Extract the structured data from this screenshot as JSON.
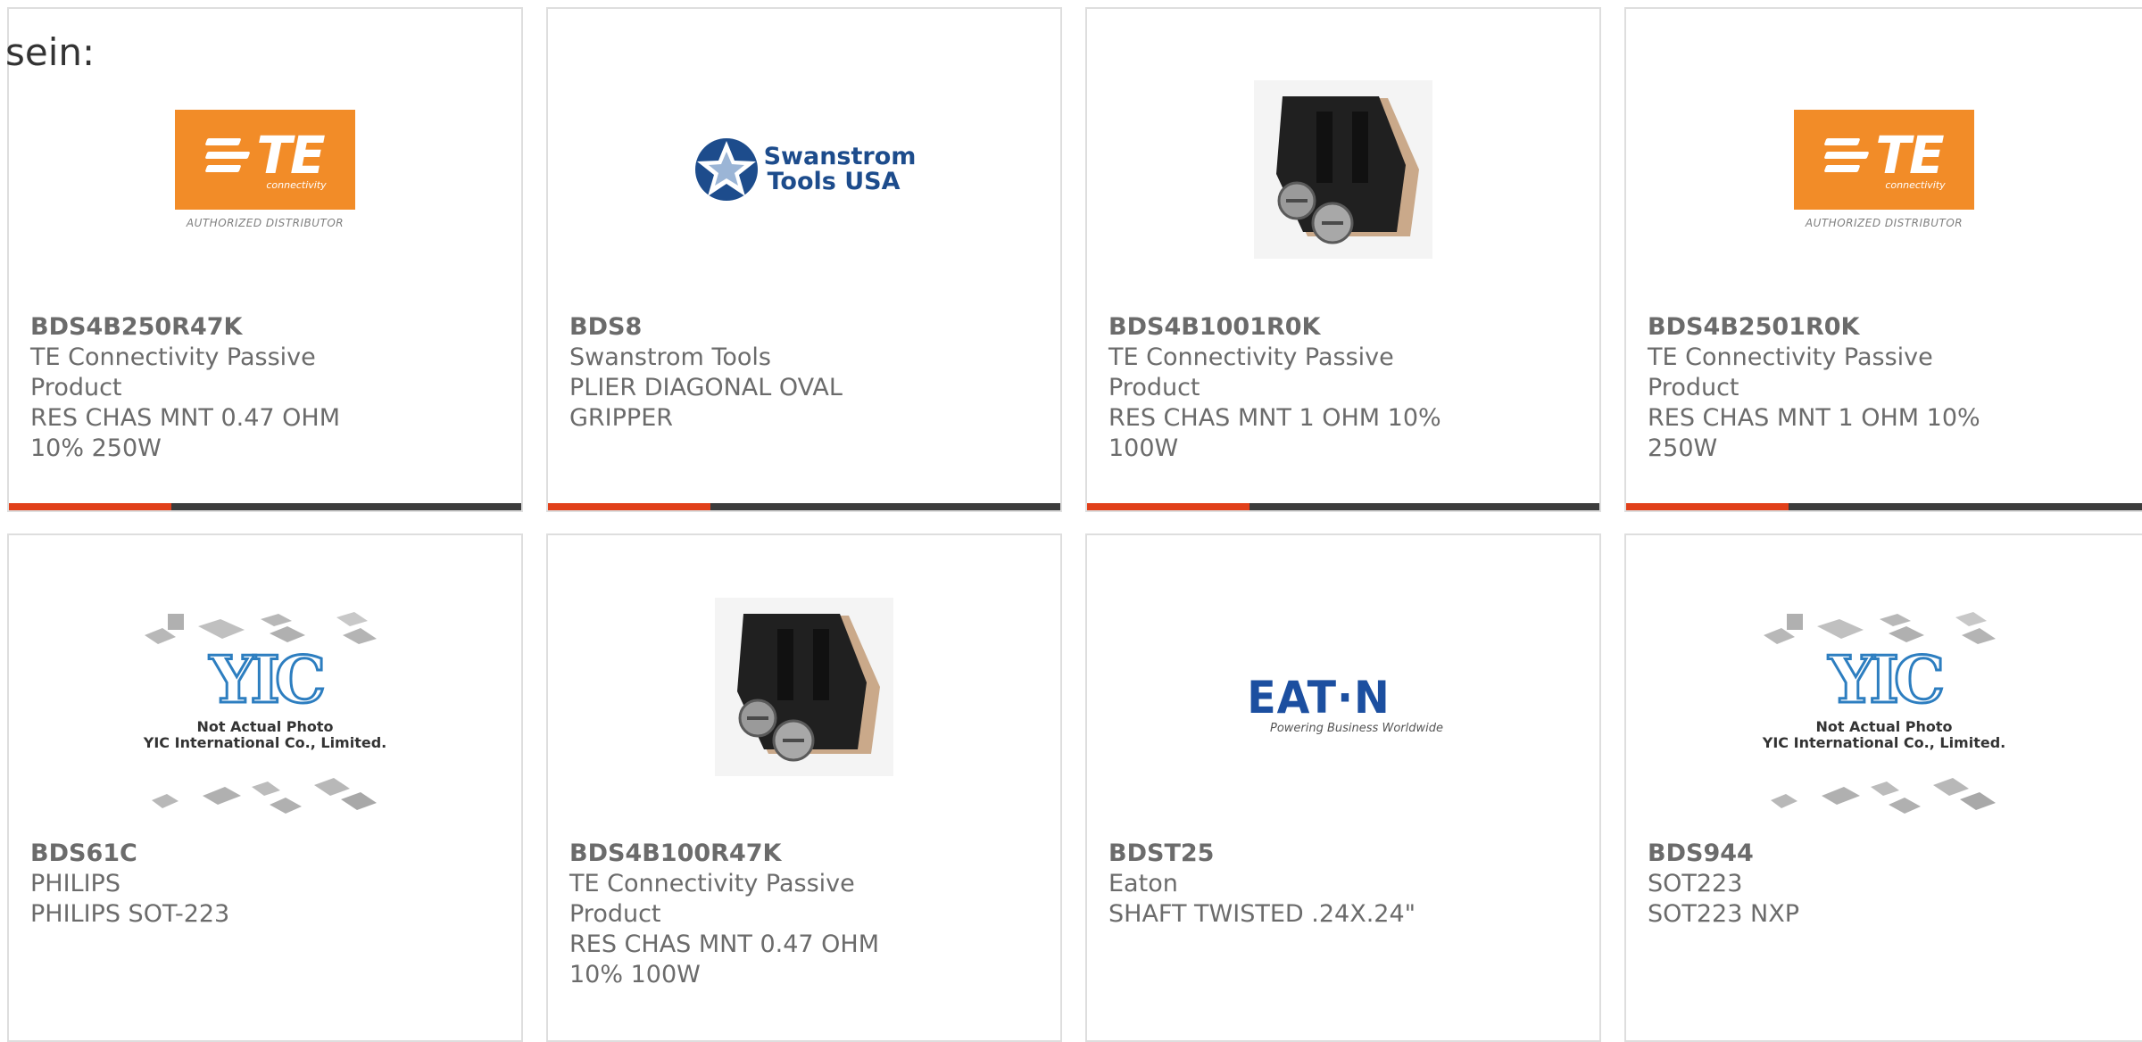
{
  "lead_text": "sein:",
  "colors": {
    "accent": "#e1401a",
    "bar": "#3c3c3c",
    "te_orange": "#f28c28",
    "swanstrom_blue": "#1d4c8c",
    "eaton_blue": "#1c4fa0",
    "yic_blue": "#2d7ec0"
  },
  "products": [
    {
      "part_number": "BDS4B250R47K",
      "manufacturer": "TE Connectivity Passive Product",
      "description": "RES CHAS MNT 0.47 OHM 10% 250W",
      "image": "te-logo"
    },
    {
      "part_number": "BDS8",
      "manufacturer": "Swanstrom Tools",
      "description": "PLIER DIAGONAL OVAL GRIPPER",
      "image": "swanstrom-logo"
    },
    {
      "part_number": "BDS4B1001R0K",
      "manufacturer": "TE Connectivity Passive Product",
      "description": "RES CHAS MNT 1 OHM 10% 100W",
      "image": "resistor-photo"
    },
    {
      "part_number": "BDS4B2501R0K",
      "manufacturer": "TE Connectivity Passive Product",
      "description": "RES CHAS MNT 1 OHM 10% 250W",
      "image": "te-logo"
    },
    {
      "part_number": "BDS61C",
      "manufacturer": "PHILIPS",
      "description": "PHILIPS SOT-223",
      "image": "yic-placeholder"
    },
    {
      "part_number": "BDS4B100R47K",
      "manufacturer": "TE Connectivity Passive Product",
      "description": "RES CHAS MNT 0.47 OHM 10% 100W",
      "image": "resistor-photo"
    },
    {
      "part_number": "BDST25",
      "manufacturer": "Eaton",
      "description": "SHAFT TWISTED .24X.24\"",
      "image": "eaton-logo"
    },
    {
      "part_number": "BDS944",
      "manufacturer": "SOT223",
      "description": "SOT223 NXP",
      "image": "yic-placeholder"
    }
  ],
  "logos": {
    "te": {
      "mark": "TE",
      "sub": "connectivity",
      "badge": "AUTHORIZED DISTRIBUTOR"
    },
    "swanstrom": {
      "line1": "Swanstrom",
      "line2": "Tools USA"
    },
    "eaton": {
      "word": "EAT·N",
      "tagline": "Powering Business Worldwide"
    },
    "yic": {
      "brand": "YIC",
      "line1": "Not Actual Photo",
      "line2": "YIC International Co., Limited."
    }
  }
}
